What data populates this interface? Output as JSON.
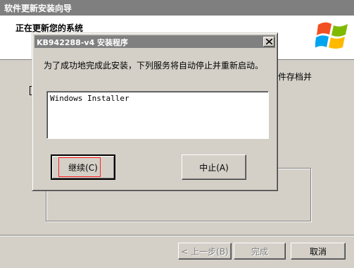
{
  "wizard": {
    "title": "软件更新安装向导",
    "heading": "正在更新您的系统",
    "body_text_partial": "件存档并",
    "buttons": {
      "back": "< 上一步(B)",
      "finish": "完成",
      "cancel": "取消"
    }
  },
  "dialog": {
    "title": "KB942288-v4 安装程序",
    "message": "为了成功地完成此安装，下列服务将自动停止并重新启动。",
    "services": [
      "Windows Installer"
    ],
    "buttons": {
      "continue": "继续(C)",
      "abort": "中止(A)"
    }
  },
  "icons": {
    "logo": "windows-xp-logo-icon",
    "close": "close-icon",
    "checkbox": "checkbox-icon"
  },
  "colors": {
    "titlebar_inactive": "#808080",
    "window_face": "#d4d0c8",
    "focus_outline": "#ff2020"
  }
}
